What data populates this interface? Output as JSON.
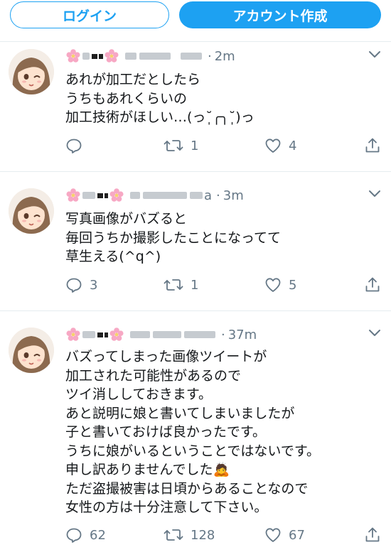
{
  "header": {
    "login_label": "ログイン",
    "signup_label": "アカウント作成"
  },
  "tweets": [
    {
      "time": "2m",
      "handle_tail": "",
      "lines": "あれが加工だとしたら\nうちもあれくらいの\n加工技術がほしい…(っ˘̩╭╮˘̩)っ",
      "reply_count": "",
      "retweet_count": "1",
      "like_count": "4"
    },
    {
      "time": "3m",
      "handle_tail": "a",
      "lines": "写真画像がバズると\n毎回うちか撮影したことになってて\n草生える(^q^)",
      "reply_count": "3",
      "retweet_count": "1",
      "like_count": "5"
    },
    {
      "time": "37m",
      "handle_tail": "",
      "lines": "バズってしまった画像ツイートが\n加工された可能性があるので\nツイ消ししておきます。\nあと説明に娘と書いてしまいましたが\n子と書いておけば良かったです。\nうちに娘がいるということではないです。\n申し訳ありませんでした🙇\nただ盗撮被害は日頃からあることなので\n女性の方は十分注意して下さい。",
      "reply_count": "62",
      "retweet_count": "128",
      "like_count": "67"
    }
  ],
  "icons": [
    "flower-icon",
    "chevron-down-icon",
    "reply-icon",
    "retweet-icon",
    "like-icon",
    "share-icon"
  ],
  "colors": {
    "accent": "#1da1f2",
    "muted": "#657786",
    "text": "#14171a",
    "divider": "#e6ecf0"
  }
}
